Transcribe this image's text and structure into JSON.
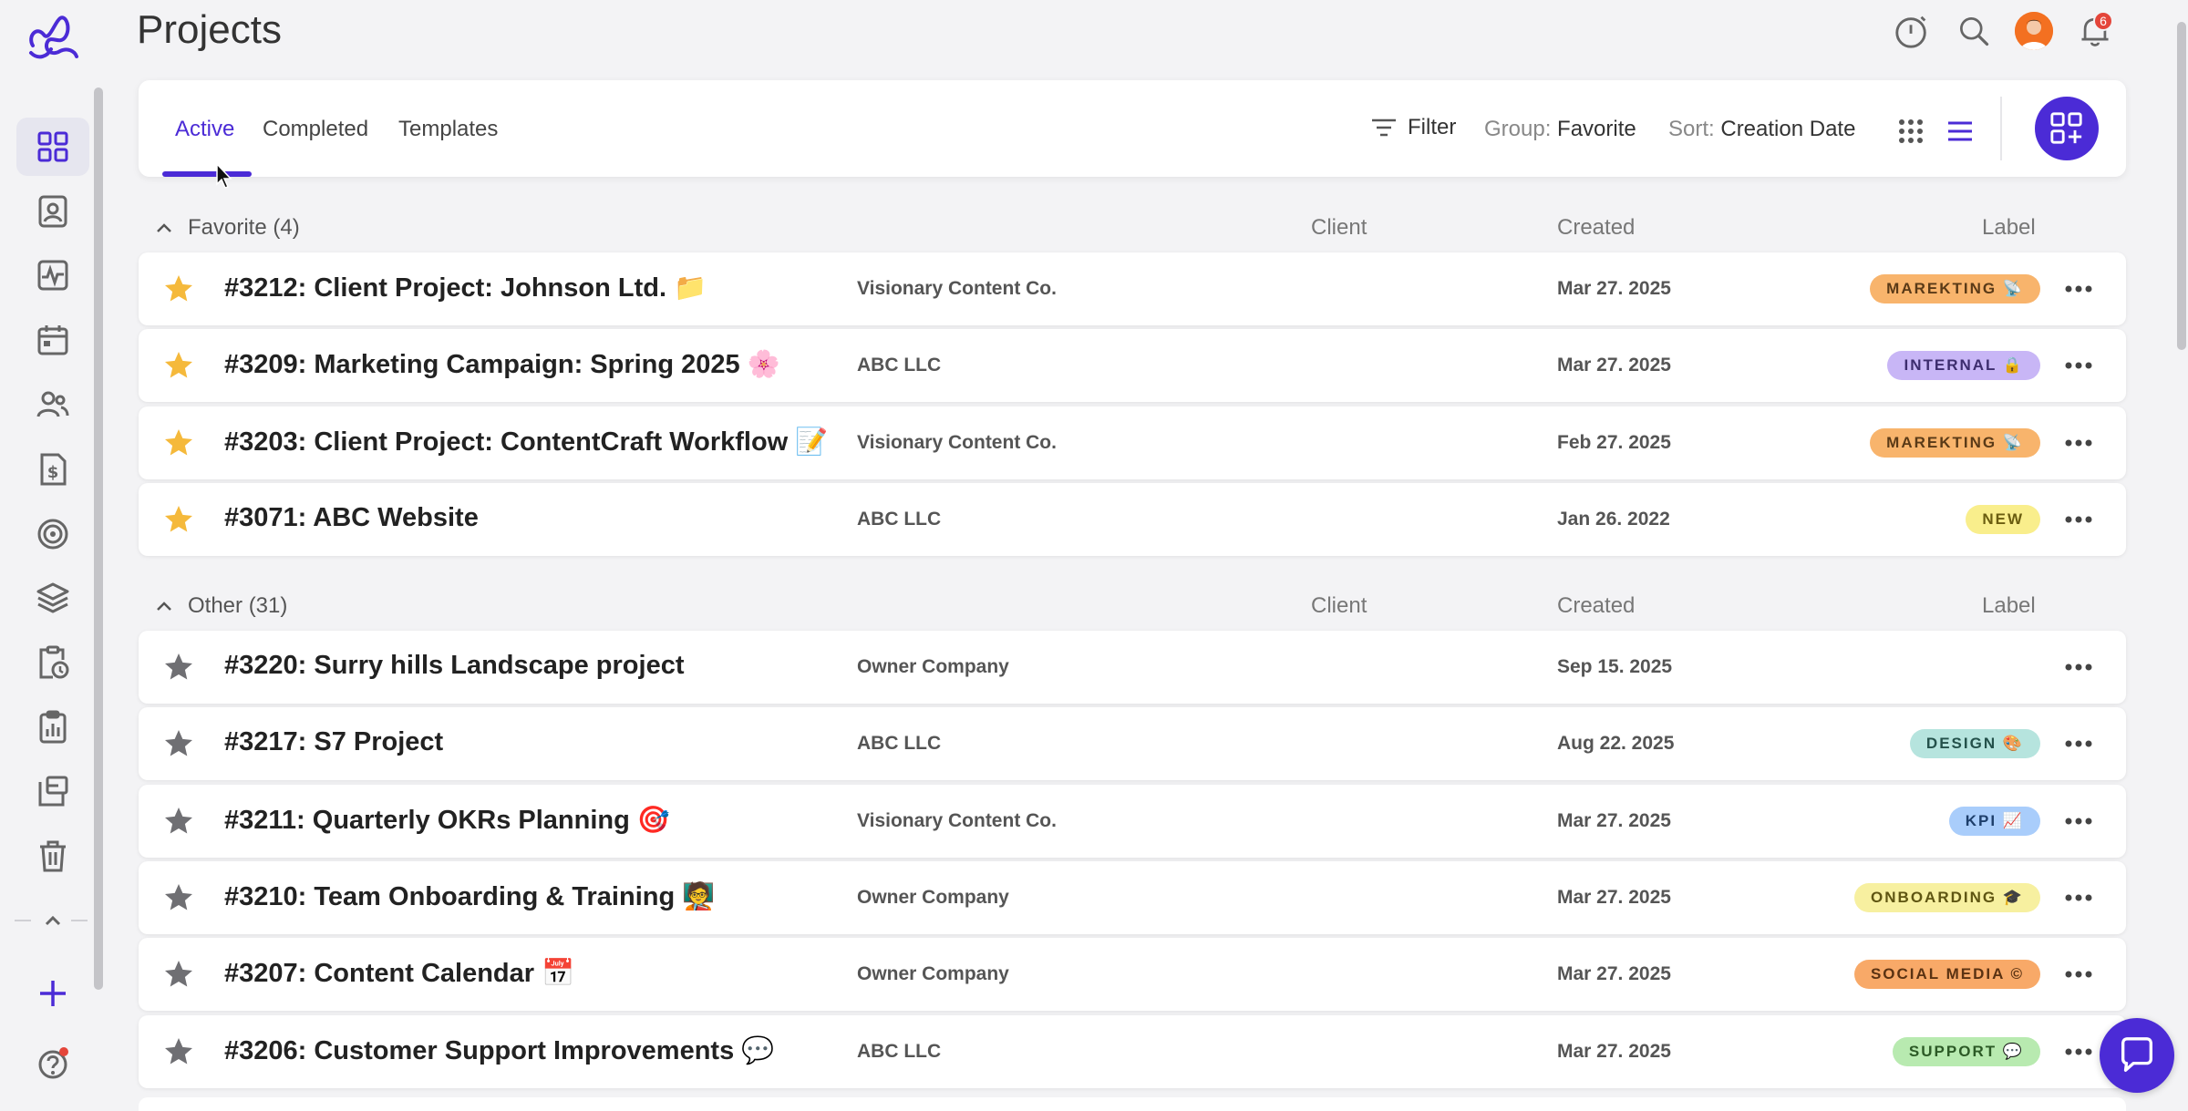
{
  "page": {
    "title": "Projects"
  },
  "colors": {
    "accent": "#4b2bd6",
    "star_favorite": "#f5b93b",
    "star_other": "#6f6f73"
  },
  "sidebar": {
    "items": [
      {
        "icon": "dashboard-grid-icon",
        "active": true
      },
      {
        "icon": "contacts-icon"
      },
      {
        "icon": "activity-icon"
      },
      {
        "icon": "calendar-icon"
      },
      {
        "icon": "team-icon"
      },
      {
        "icon": "invoice-icon"
      },
      {
        "icon": "goals-target-icon"
      },
      {
        "icon": "layers-icon"
      },
      {
        "icon": "timesheet-icon"
      },
      {
        "icon": "reports-clipboard-icon"
      },
      {
        "icon": "boards-icon"
      },
      {
        "icon": "trash-icon"
      }
    ]
  },
  "header_icons": [
    "timer-icon",
    "search-icon",
    "avatar",
    "bell-icon"
  ],
  "notifications": {
    "count": "6"
  },
  "tabs": [
    {
      "label": "Active",
      "active": true
    },
    {
      "label": "Completed"
    },
    {
      "label": "Templates"
    }
  ],
  "toolbar": {
    "filter_label": "Filter",
    "group_prefix": "Group:",
    "group_value": "Favorite",
    "sort_prefix": "Sort:",
    "sort_value": "Creation Date"
  },
  "columns": {
    "client": "Client",
    "created": "Created",
    "label": "Label"
  },
  "groups": [
    {
      "title": "Favorite (4)",
      "rows": [
        {
          "title": "#3212: Client Project: Johnson Ltd. 📁",
          "client": "Visionary Content Co.",
          "created": "Mar 27. 2025",
          "label": "MAREKTING 📡",
          "label_bg": "#f8b46c",
          "label_fg": "#5a3a17"
        },
        {
          "title": "#3209: Marketing Campaign: Spring 2025 🌸",
          "client": "ABC LLC",
          "created": "Mar 27. 2025",
          "label": "INTERNAL 🔒",
          "label_bg": "#c8b6f6",
          "label_fg": "#3d2d6e"
        },
        {
          "title": "#3203: Client Project: ContentCraft Workflow 📝",
          "client": "Visionary Content Co.",
          "created": "Feb 27. 2025",
          "label": "MAREKTING 📡",
          "label_bg": "#f8b46c",
          "label_fg": "#5a3a17"
        },
        {
          "title": "#3071: ABC Website",
          "client": "ABC LLC",
          "created": "Jan 26. 2022",
          "label": "NEW",
          "label_bg": "#f9ee8c",
          "label_fg": "#6b5d10"
        }
      ]
    },
    {
      "title": "Other (31)",
      "rows": [
        {
          "title": "#3220: Surry hills Landscape project",
          "client": "Owner Company",
          "created": "Sep 15. 2025",
          "label": "",
          "label_bg": "",
          "label_fg": ""
        },
        {
          "title": "#3217: S7 Project",
          "client": "ABC LLC",
          "created": "Aug 22. 2025",
          "label": "DESIGN 🎨",
          "label_bg": "#b6e4de",
          "label_fg": "#24514b"
        },
        {
          "title": "#3211: Quarterly OKRs Planning 🎯",
          "client": "Visionary Content Co.",
          "created": "Mar 27. 2025",
          "label": "KPI 📈",
          "label_bg": "#a9cdfb",
          "label_fg": "#1e3f6b"
        },
        {
          "title": "#3210: Team Onboarding & Training 🧑‍🏫",
          "client": "Owner Company",
          "created": "Mar 27. 2025",
          "label": "ONBOARDING 🎓",
          "label_bg": "#f7f0a0",
          "label_fg": "#5f5512"
        },
        {
          "title": "#3207: Content Calendar 📅",
          "client": "Owner Company",
          "created": "Mar 27. 2025",
          "label": "SOCIAL MEDIA ©",
          "label_bg": "#f8a968",
          "label_fg": "#5a3212"
        },
        {
          "title": "#3206: Customer Support Improvements 💬",
          "client": "ABC LLC",
          "created": "Mar 27. 2025",
          "label": "SUPPORT 💬",
          "label_bg": "#b8eab0",
          "label_fg": "#2c5a26"
        }
      ]
    }
  ]
}
